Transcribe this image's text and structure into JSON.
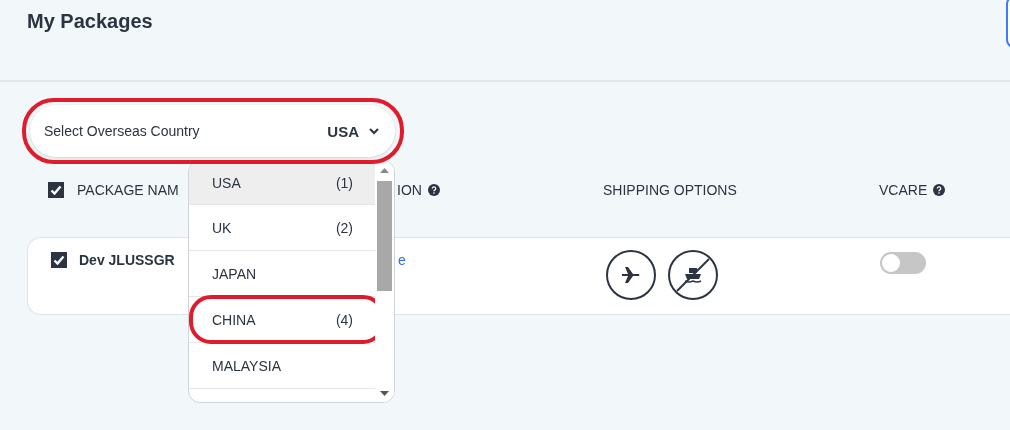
{
  "page_title": "My Packages",
  "country_select": {
    "label": "Select Overseas Country",
    "value": "USA",
    "expanded": true,
    "highlighted": true
  },
  "dropdown": {
    "items": [
      {
        "name": "USA",
        "count": "(1)",
        "selected": true,
        "highlighted": false
      },
      {
        "name": "UK",
        "count": "(2)",
        "selected": false,
        "highlighted": false
      },
      {
        "name": "JAPAN",
        "selected": false,
        "highlighted": false
      },
      {
        "name": "CHINA",
        "count": "(4)",
        "selected": false,
        "highlighted": true
      },
      {
        "name": "MALAYSIA",
        "selected": false,
        "highlighted": false
      }
    ]
  },
  "table": {
    "header_checked": true,
    "columns": [
      {
        "label": "PACKAGE NAM",
        "help": false
      },
      {
        "label": "ION",
        "help": true
      },
      {
        "label": "SHIPPING OPTIONS",
        "help": false
      },
      {
        "label": "VCARE",
        "help": true
      }
    ],
    "rows": [
      {
        "checked": true,
        "name": "Dev JLUSSGR",
        "link": "e",
        "shipping": [
          {
            "kind": "air",
            "available": true
          },
          {
            "kind": "sea",
            "available": false
          }
        ],
        "vcare_on": false
      }
    ]
  }
}
